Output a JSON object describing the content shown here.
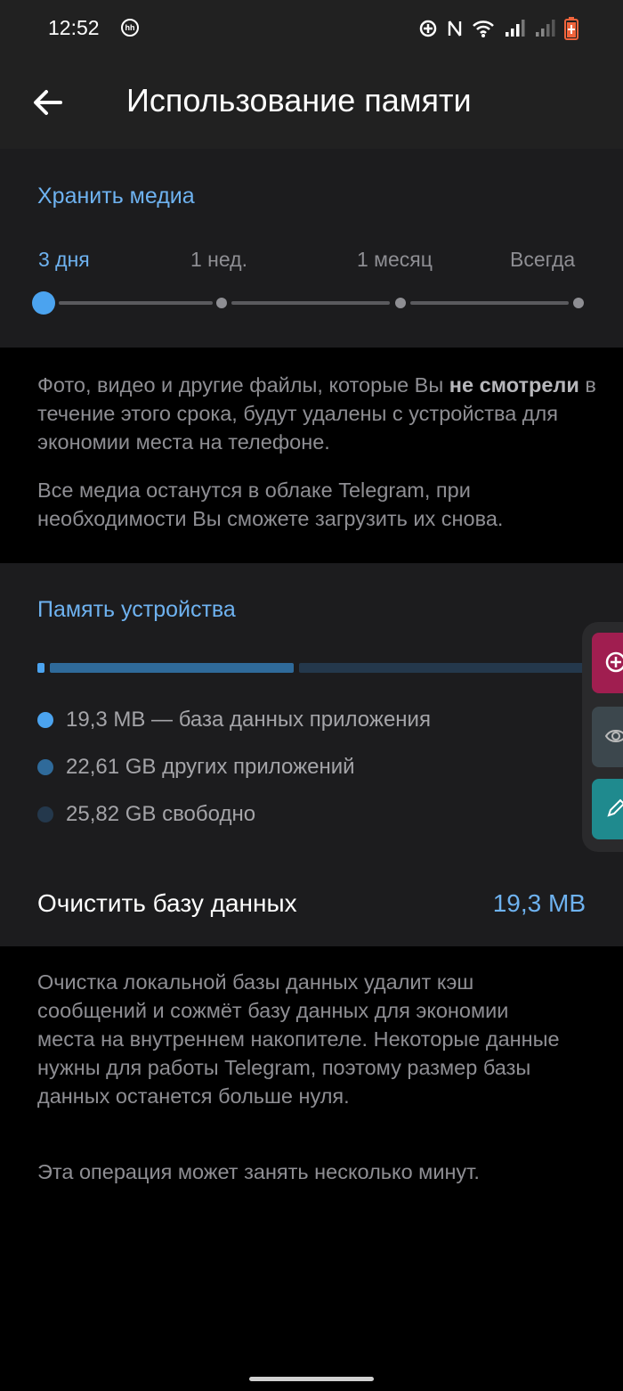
{
  "status_bar": {
    "time": "12:52",
    "notification_badge": "hh",
    "icons": [
      "sync-icon",
      "nfc-icon",
      "wifi-icon",
      "signal-icon",
      "signal-icon",
      "battery-charging-icon"
    ]
  },
  "app_bar": {
    "title": "Использование памяти",
    "back_icon": "arrow-left-icon"
  },
  "keep_media": {
    "header": "Хранить медиа",
    "options": [
      "3 дня",
      "1 нед.",
      "1 месяц",
      "Всегда"
    ],
    "selected": "3 дня",
    "selected_index": 0,
    "description_part1": "Фото, видео и другие файлы, которые Вы ",
    "description_bold": "не смотрели",
    "description_part2": " в течение этого срока, будут удалены с устройства для экономии места на телефоне.",
    "description2": "Все медиа останутся в облаке Telegram, при необходимости Вы сможете загрузить их снова."
  },
  "device_storage": {
    "header": "Память устройства",
    "legend": [
      {
        "label": "19,3 MB — база данных приложения",
        "color": "#4ba3ef"
      },
      {
        "label": "22,61 GB других приложений",
        "color": "#2f6a9a"
      },
      {
        "label": "25,82 GB свободно",
        "color": "#24384c"
      }
    ],
    "clear_label": "Очистить базу данных",
    "clear_value": "19,3 MB"
  },
  "clear_info": {
    "text": "Очистка локальной базы данных удалит кэш сообщений и сожмёт базу данных для экономии места на внутреннем накопителе. Некоторые данные нужны для работы Telegram, поэтому размер базы данных останется больше нуля.",
    "note": "Эта операция может занять несколько минут."
  },
  "side_panel": {
    "buttons": [
      {
        "icon": "add-icon",
        "color": "#a01e50"
      },
      {
        "icon": "eye-icon",
        "color": "#3c474d"
      },
      {
        "icon": "pencil-icon",
        "color": "#1f8a8e"
      }
    ]
  },
  "colors": {
    "accent": "#6eb2f0",
    "background": "#000000",
    "surface": "#1c1c1e",
    "header": "#212121"
  }
}
